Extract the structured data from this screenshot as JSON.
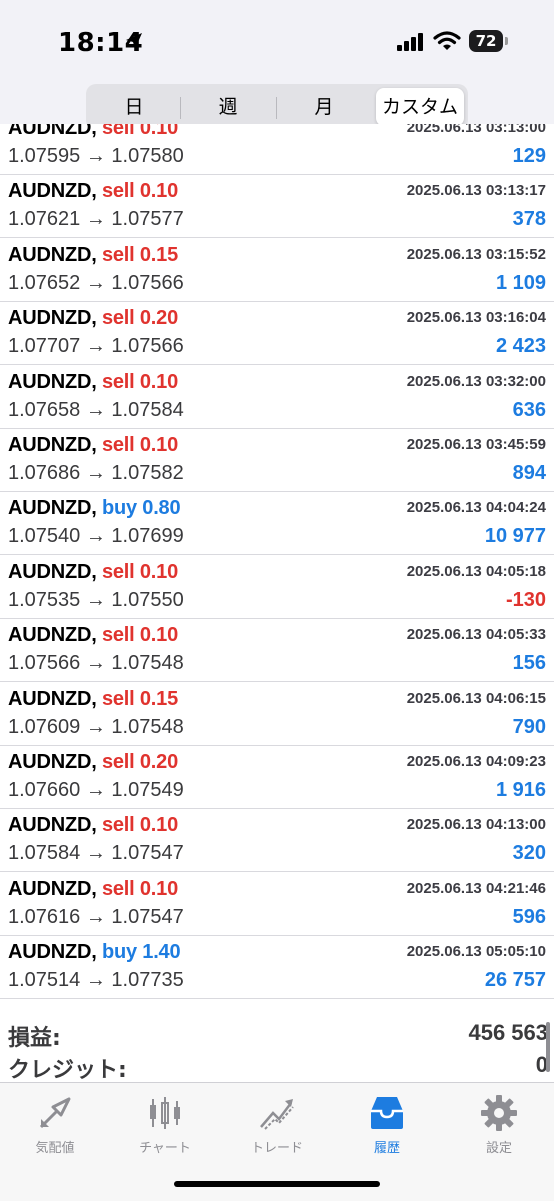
{
  "status_bar": {
    "time": "18:14",
    "battery": "72"
  },
  "segments": {
    "items": [
      "日",
      "週",
      "月",
      "カスタム"
    ],
    "active": "カスタム"
  },
  "rows": [
    {
      "symbol": "AUDNZD,",
      "side": "sell",
      "lot": "0.10",
      "date": "2025.06.13 03:13:00",
      "prices": "1.07595 → 1.07580",
      "profit": "129"
    },
    {
      "symbol": "AUDNZD,",
      "side": "sell",
      "lot": "0.10",
      "date": "2025.06.13 03:13:17",
      "prices": "1.07621 → 1.07577",
      "profit": "378"
    },
    {
      "symbol": "AUDNZD,",
      "side": "sell",
      "lot": "0.15",
      "date": "2025.06.13 03:15:52",
      "prices": "1.07652 → 1.07566",
      "profit": "1 109"
    },
    {
      "symbol": "AUDNZD,",
      "side": "sell",
      "lot": "0.20",
      "date": "2025.06.13 03:16:04",
      "prices": "1.07707 → 1.07566",
      "profit": "2 423"
    },
    {
      "symbol": "AUDNZD,",
      "side": "sell",
      "lot": "0.10",
      "date": "2025.06.13 03:32:00",
      "prices": "1.07658 → 1.07584",
      "profit": "636"
    },
    {
      "symbol": "AUDNZD,",
      "side": "sell",
      "lot": "0.10",
      "date": "2025.06.13 03:45:59",
      "prices": "1.07686 → 1.07582",
      "profit": "894"
    },
    {
      "symbol": "AUDNZD,",
      "side": "buy",
      "lot": "0.80",
      "date": "2025.06.13 04:04:24",
      "prices": "1.07540 → 1.07699",
      "profit": "10 977"
    },
    {
      "symbol": "AUDNZD,",
      "side": "sell",
      "lot": "0.10",
      "date": "2025.06.13 04:05:18",
      "prices": "1.07535 → 1.07550",
      "profit": "-130"
    },
    {
      "symbol": "AUDNZD,",
      "side": "sell",
      "lot": "0.10",
      "date": "2025.06.13 04:05:33",
      "prices": "1.07566 → 1.07548",
      "profit": "156"
    },
    {
      "symbol": "AUDNZD,",
      "side": "sell",
      "lot": "0.15",
      "date": "2025.06.13 04:06:15",
      "prices": "1.07609 → 1.07548",
      "profit": "790"
    },
    {
      "symbol": "AUDNZD,",
      "side": "sell",
      "lot": "0.20",
      "date": "2025.06.13 04:09:23",
      "prices": "1.07660 → 1.07549",
      "profit": "1 916"
    },
    {
      "symbol": "AUDNZD,",
      "side": "sell",
      "lot": "0.10",
      "date": "2025.06.13 04:13:00",
      "prices": "1.07584 → 1.07547",
      "profit": "320"
    },
    {
      "symbol": "AUDNZD,",
      "side": "sell",
      "lot": "0.10",
      "date": "2025.06.13 04:21:46",
      "prices": "1.07616 → 1.07547",
      "profit": "596"
    },
    {
      "symbol": "AUDNZD,",
      "side": "buy",
      "lot": "1.40",
      "date": "2025.06.13 05:05:10",
      "prices": "1.07514 → 1.07735",
      "profit": "26 757"
    }
  ],
  "summary": {
    "profit_label": "損益:",
    "profit_value": "456 563",
    "credit_label": "クレジット:",
    "credit_value": "0"
  },
  "tabs": [
    {
      "label": "気配値",
      "icon": "quotes-icon"
    },
    {
      "label": "チャート",
      "icon": "chart-icon"
    },
    {
      "label": "トレード",
      "icon": "trade-icon"
    },
    {
      "label": "履歴",
      "icon": "history-icon",
      "active": true
    },
    {
      "label": "設定",
      "icon": "gear-icon"
    }
  ],
  "colors": {
    "sell": "#e0332e",
    "buy": "#1d7ce0",
    "active_tab": "#1d7ce0",
    "inactive_tab": "#8e8e93"
  }
}
